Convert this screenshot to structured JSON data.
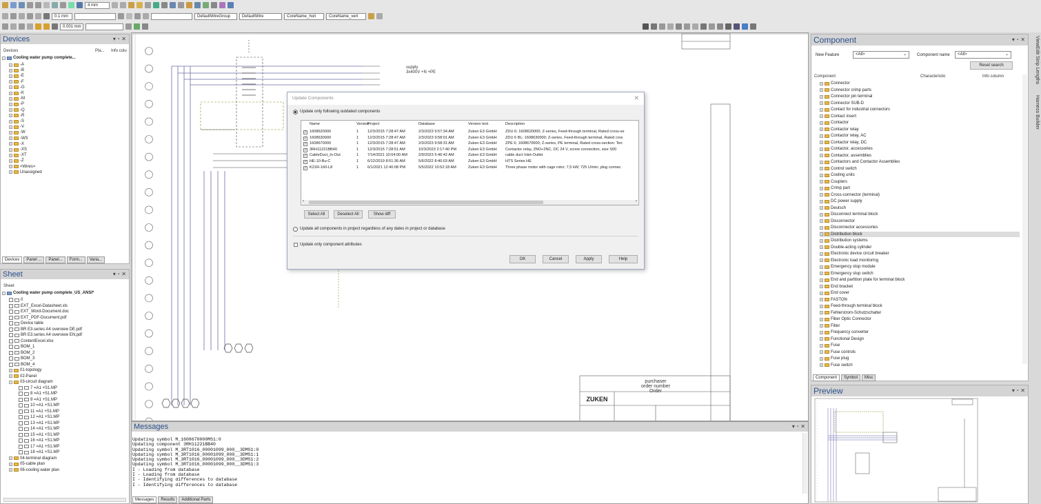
{
  "toolbar": {
    "line_width_1": "4 mm",
    "line_width_2": "0.1 mm",
    "line_width_3": "0.001 mm",
    "wire_group": "DefaultWireGroup",
    "wire": "DefaultWire",
    "core_hori": "CoreName_hori",
    "core_vert": "CoreName_vert"
  },
  "devices_pane": {
    "title": "Devices",
    "columns": [
      "Devices",
      "Pla...",
      "Info colu"
    ],
    "root": "Cooling water pump complete...",
    "items": [
      "-A",
      "-B",
      "-E",
      "-F",
      "-G",
      "-K",
      "-M",
      "-P",
      "-Q",
      "-R",
      "-S",
      "-V",
      "-W",
      "-WS",
      "-X",
      "-XS",
      "-XT",
      "-Z",
      "<Wires>",
      "Unassigned"
    ],
    "tabs": [
      "Devices",
      "Panel ...",
      "Panel...",
      "Form...",
      "Varia..."
    ]
  },
  "sheet_pane": {
    "title": "Sheet",
    "column": "Sheet",
    "root": "Cooling water pump complete_US_ANSI*",
    "items": [
      {
        "label": "0",
        "level": 1,
        "kind": "sheet"
      },
      {
        "label": "EXT_Excel-Datasheet.xls",
        "level": 1,
        "kind": "doc"
      },
      {
        "label": "EXT_Word-Document.doc",
        "level": 1,
        "kind": "doc"
      },
      {
        "label": "EXT_PDF-Document.pdf",
        "level": 1,
        "kind": "doc"
      },
      {
        "label": "Device table",
        "level": 1,
        "kind": "doc"
      },
      {
        "label": "BR E3.series A4 overview DE.pdf",
        "level": 1,
        "kind": "doc"
      },
      {
        "label": "BR E3.series A4 overview EN.pdf",
        "level": 1,
        "kind": "doc"
      },
      {
        "label": "ContentExcel.xlsx",
        "level": 1,
        "kind": "doc"
      },
      {
        "label": "BOM_1",
        "level": 1,
        "kind": "sheet"
      },
      {
        "label": "BOM_2",
        "level": 1,
        "kind": "sheet"
      },
      {
        "label": "BOM_3",
        "level": 1,
        "kind": "sheet"
      },
      {
        "label": "BOM_4",
        "level": 1,
        "kind": "sheet"
      },
      {
        "label": "01-topology",
        "level": 1,
        "kind": "folder"
      },
      {
        "label": "02-Panel",
        "level": 1,
        "kind": "folder"
      },
      {
        "label": "03-circuit diagram",
        "level": 1,
        "kind": "folder"
      },
      {
        "label": "7 =A1 +S1.MP",
        "level": 2,
        "kind": "sheet"
      },
      {
        "label": "8 =A1 +S1.MP",
        "level": 2,
        "kind": "sheet"
      },
      {
        "label": "9 =A1 +S1.MP",
        "level": 2,
        "kind": "sheet"
      },
      {
        "label": "10 =A1 +S1.MP",
        "level": 2,
        "kind": "sheet"
      },
      {
        "label": "11 =A1 +S1.MP",
        "level": 2,
        "kind": "sheet"
      },
      {
        "label": "12 =A1 +S1.MP",
        "level": 2,
        "kind": "sheet"
      },
      {
        "label": "13 =A1 +S1.MP",
        "level": 2,
        "kind": "sheet"
      },
      {
        "label": "14 =A1 +S1.MP",
        "level": 2,
        "kind": "sheet"
      },
      {
        "label": "15 =A1 +S1.MP",
        "level": 2,
        "kind": "sheet"
      },
      {
        "label": "16 =A1 +S1.MP",
        "level": 2,
        "kind": "sheet"
      },
      {
        "label": "17 =A1 +S1.MP",
        "level": 2,
        "kind": "sheet"
      },
      {
        "label": "18 =A1 +S1.MP",
        "level": 2,
        "kind": "sheet"
      },
      {
        "label": "04-terminal diagram",
        "level": 1,
        "kind": "folder"
      },
      {
        "label": "05-cable plan",
        "level": 1,
        "kind": "folder"
      },
      {
        "label": "06-cooling water plan",
        "level": 1,
        "kind": "folder"
      }
    ]
  },
  "drawing": {
    "supply_label": "supply",
    "supply_voltage": "3x400V +N +PE",
    "title_block": {
      "purchaser": "purchaser",
      "order_number": "order number",
      "order": "Order",
      "logo": "ZUKEN"
    }
  },
  "dialog": {
    "title": "Update Components",
    "radio1": "Update only following outdated components",
    "columns": [
      "Name",
      "Version",
      "Project",
      "Database",
      "Version text",
      "Description"
    ],
    "rows": [
      {
        "name": "1608620000",
        "version": "1",
        "project": "12/3/2015 7:28:47 AM",
        "database": "2/3/2023 9:57:34 AM",
        "version_text": "Zuken E3 GmbH",
        "description": "ZDU 6; 1608620000; Z-series, Feed-through terminal, Rated cross-se"
      },
      {
        "name": "1608630000",
        "version": "1",
        "project": "12/3/2015 7:28:47 AM",
        "database": "2/3/2023 9:58:01 AM",
        "version_text": "Zuken E3 GmbH",
        "description": "ZDU 6 BL; 1608630000; Z-series, Feed-through terminal, Rated cros"
      },
      {
        "name": "1608670000",
        "version": "1",
        "project": "12/3/2015 7:28:47 AM",
        "database": "2/3/2023 9:58:31 AM",
        "version_text": "Zuken E3 GmbH",
        "description": "ZPE 6; 1608670000; Z-series, PE terminal, Rated cross-section: Ten"
      },
      {
        "name": "3RH11221BB40",
        "version": "1",
        "project": "12/3/2015 7:28:51 AM",
        "database": "10/3/2023 2:17:40 PM",
        "version_text": "Zuken E3 GmbH",
        "description": "Contactor relay, 2NO+2NC, DC 24 V, screw connection, size S00"
      },
      {
        "name": "CableDuct_In-Out",
        "version": "1",
        "project": "7/14/2021 10:04:00 AM",
        "database": "2/9/2023 5:46:42 AM",
        "version_text": "Zuken E3 GmbH",
        "description": "cable duct Inlet-Outlet"
      },
      {
        "name": "HE-10-Bu-C",
        "version": "1",
        "project": "6/12/2019 8:51:36 AM",
        "database": "5/6/2022 8:40:03 AM",
        "version_text": "Zuken E3 GmbH",
        "description": "HTS Series HE"
      },
      {
        "name": "K21R-160-L8",
        "version": "1",
        "project": "6/1/2021 12:40:08 PM",
        "database": "5/5/2022 10:52:18 AM",
        "version_text": "Zuken E3 GmbH",
        "description": "Three phase motor with cage rotor; 7,5 kW; 725 U/min; plug connec"
      }
    ],
    "select_all": "Select All",
    "deselect_all": "Deselect All",
    "show_diff": "Show diff",
    "radio2": "Update all components in project regardless of any dates in project or database",
    "checkbox": "Update only component attributes",
    "ok": "OK",
    "cancel": "Cancel",
    "apply": "Apply",
    "help": "Help"
  },
  "messages": {
    "title": "Messages",
    "lines": [
      "Updating symbol M_1608670000MS1:0",
      "Updating component 3RH11221BB40",
      "Updating symbol M_3RT1016_00001099_000__3DMS1:0",
      "Updating symbol M_3RT1016_00001099_000__3DMS1:1",
      "Updating symbol M_3RT1016_00001099_000__3DMS1:2",
      "Updating symbol M_3RT1016_00001099_000__3DMS1:3",
      "I - Loading from database",
      "I - Loading from database",
      "I - Identifying differences to database",
      "I - Identifying differences to database"
    ],
    "tabs": [
      "Messages",
      "Results",
      "Additional Parts"
    ]
  },
  "component_pane": {
    "title": "Component",
    "new_feature_label": "New Feature",
    "new_feature_value": "<All>",
    "component_name_label": "Component name",
    "component_name_value": "<All>",
    "reset_search": "Reset search",
    "columns": [
      "Component",
      "Characteristic",
      "Info column"
    ],
    "items": [
      "Connector",
      "Connector crimp parts",
      "Connector pin terminal",
      "Connector SUB-D",
      "Contact for industrial connectors",
      "Contact insert",
      "Contactor",
      "Contactor relay",
      "Contactor relay, AC",
      "Contactor relay, DC",
      "Contactor, accessories",
      "Contactor, assemblies",
      "Contactors and Contactor Assemblies",
      "Control switch",
      "Cooling units",
      "Couplers",
      "Crimp part",
      "Cross-connector (terminal)",
      "DC power supply",
      "Deutsch",
      "Disconnect terminal block",
      "Disconnector",
      "Disconnector accessories",
      "Distribution block",
      "Distribution systems",
      "Double-acting cylinder",
      "Electronic device circuit breaker",
      "Electronic load monitoring",
      "Emergency stop module",
      "Emergency stop switch",
      "End and partition plate for terminal block",
      "End bracket",
      "End cover",
      "FASTON",
      "Feed-through terminal block",
      "Fehlerstrom-Schutzschalter",
      "Fiber Optic Connector",
      "Filter",
      "Frequency converter",
      "Functional Design",
      "Fuse",
      "Fuse controls",
      "Fuse plug",
      "Fuse switch"
    ],
    "selected_item": "Distribution block",
    "tabs": [
      "Component",
      "Symbol",
      "Misc"
    ]
  },
  "preview_pane": {
    "title": "Preview"
  },
  "side_tabs": {
    "viewer": "ViewEdit Strip Lengths",
    "harness": "Harness Builder"
  }
}
